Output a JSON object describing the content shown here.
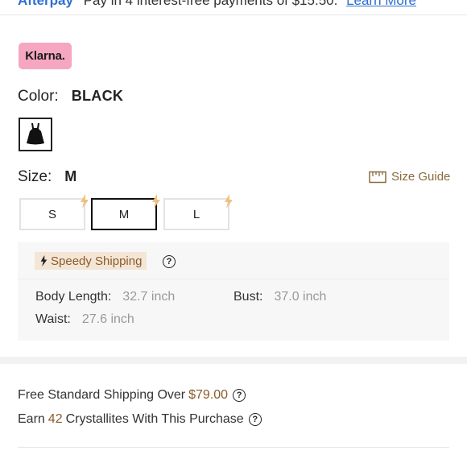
{
  "top_banner": {
    "logo": "Afterpay",
    "text": "Pay in 4 interest-free payments of $15.50.",
    "link": "Learn More"
  },
  "klarna_badge": "Klarna.",
  "color": {
    "label": "Color:",
    "value": "BLACK"
  },
  "size": {
    "label": "Size:",
    "value": "M"
  },
  "size_guide_label": "Size Guide",
  "size_options": [
    "S",
    "M",
    "L"
  ],
  "shipping_box": {
    "tag": "Speedy Shipping",
    "measurements": [
      {
        "label": "Body Length:",
        "value": "32.7 inch"
      },
      {
        "label": "Bust:",
        "value": "37.0 inch"
      },
      {
        "label": "Waist:",
        "value": "27.6 inch"
      }
    ]
  },
  "info": {
    "free_shipping_prefix": "Free Standard Shipping Over",
    "free_shipping_amount": "$79.00",
    "earn_prefix": "Earn",
    "earn_amount": "42",
    "earn_suffix": "Crystallites With This Purchase"
  },
  "colors": {
    "accent": "#8a5a2a",
    "klarna": "#f6a6c0",
    "bolt": "#f0c080"
  }
}
